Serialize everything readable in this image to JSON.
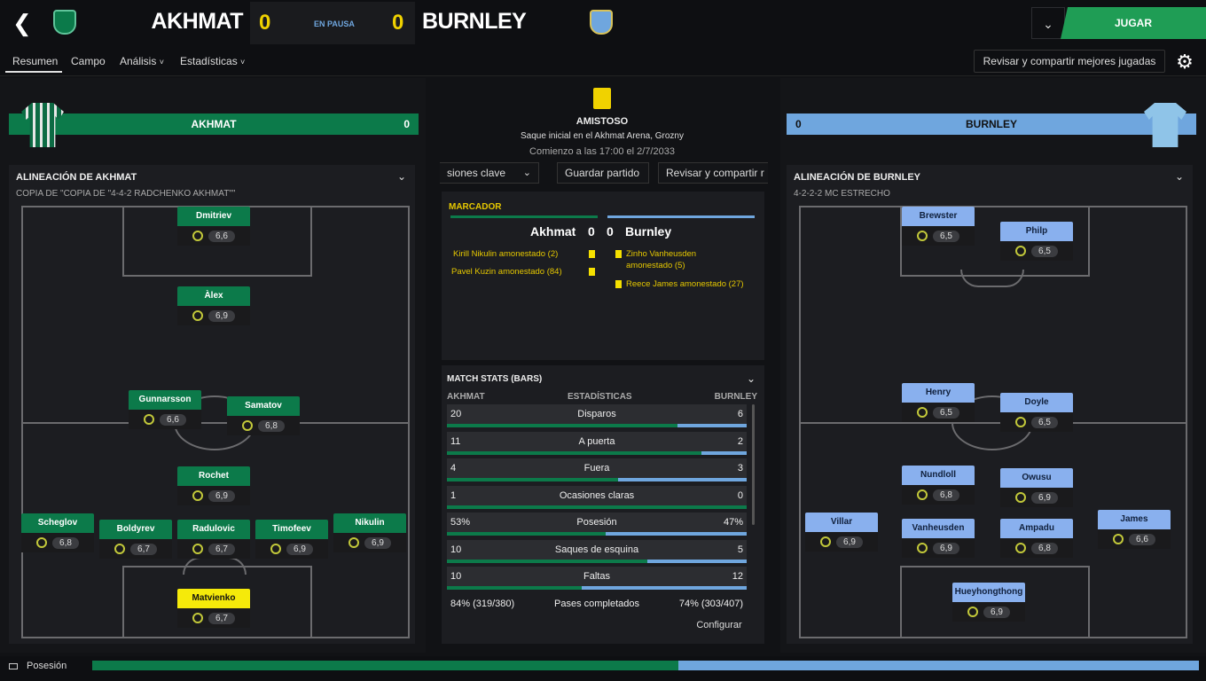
{
  "header": {
    "home_team": "AKHMAT",
    "away_team": "BURNLEY",
    "home_score": "0",
    "away_score": "0",
    "status": "EN PAUSA",
    "play_label": "JUGAR",
    "back_icon": "chevron-left-icon"
  },
  "nav": {
    "tabs": [
      "Resumen",
      "Campo",
      "Análisis",
      "Estadísticas"
    ],
    "share_label": "Revisar y compartir mejores jugadas",
    "settings_icon": "gear-icon"
  },
  "colors": {
    "home": "#0c7a4a",
    "away": "#6fa6de",
    "accent_yellow": "#f0d200"
  },
  "home_panel": {
    "bar_name": "AKHMAT",
    "bar_score": "0",
    "lineup_title": "ALINEACIÓN DE AKHMAT",
    "formation": "COPIA DE \"COPIA DE \"4-4-2 RADCHENKO AKHMAT\"\"",
    "players": [
      {
        "name": "Dmitriev",
        "rating": "6,6"
      },
      {
        "name": "Àlex",
        "rating": "6,9"
      },
      {
        "name": "Gunnarsson",
        "rating": "6,6"
      },
      {
        "name": "Samatov",
        "rating": "6,8"
      },
      {
        "name": "Rochet",
        "rating": "6,9"
      },
      {
        "name": "Scheglov",
        "rating": "6,8"
      },
      {
        "name": "Boldyrev",
        "rating": "6,7"
      },
      {
        "name": "Radulovic",
        "rating": "6,7"
      },
      {
        "name": "Timofeev",
        "rating": "6,9"
      },
      {
        "name": "Nikulin",
        "rating": "6,9"
      },
      {
        "name": "Matvienko",
        "rating": "6,7"
      }
    ]
  },
  "away_panel": {
    "bar_name": "BURNLEY",
    "bar_score": "0",
    "lineup_title": "ALINEACIÓN DE BURNLEY",
    "formation": "4-2-2-2 MC ESTRECHO",
    "players": [
      {
        "name": "Brewster",
        "rating": "6,5"
      },
      {
        "name": "Philp",
        "rating": "6,5"
      },
      {
        "name": "Henry",
        "rating": "6,5"
      },
      {
        "name": "Doyle",
        "rating": "6,5"
      },
      {
        "name": "Nundloll",
        "rating": "6,8"
      },
      {
        "name": "Owusu",
        "rating": "6,9"
      },
      {
        "name": "Villar",
        "rating": "6,9"
      },
      {
        "name": "Vanheusden",
        "rating": "6,9"
      },
      {
        "name": "Ampadu",
        "rating": "6,8"
      },
      {
        "name": "James",
        "rating": "6,6"
      },
      {
        "name": "Hueyhongthong",
        "rating": "6,9"
      }
    ]
  },
  "match": {
    "competition": "AMISTOSO",
    "kickoff": "Saque inicial en el Akhmat Arena, Grozny",
    "start": "Comienzo a las 17:00 el 2/7/2033",
    "btn_highlights": "siones clave",
    "btn_save": "Guardar partido",
    "btn_share": "Revisar y compartir r"
  },
  "scoreboard": {
    "title": "MARCADOR",
    "home": "Akhmat",
    "home_score": "0",
    "away": "Burnley",
    "away_score": "0",
    "home_events": [
      "Kirill Nikulin amonestado (2)",
      "Pavel Kuzin amonestado (84)"
    ],
    "away_events": [
      "Zinho Vanheusden amonestado (5)",
      "Reece James amonestado (27)"
    ]
  },
  "stats": {
    "title": "MATCH STATS (BARS)",
    "col_home": "AKHMAT",
    "col_mid": "ESTADÍSTICAS",
    "col_away": "BURNLEY",
    "rows": [
      {
        "label": "Disparos",
        "home": "20",
        "away": "6",
        "share": 0.77
      },
      {
        "label": "A puerta",
        "home": "11",
        "away": "2",
        "share": 0.85
      },
      {
        "label": "Fuera",
        "home": "4",
        "away": "3",
        "share": 0.57
      },
      {
        "label": "Ocasiones claras",
        "home": "1",
        "away": "0",
        "share": 1.0
      },
      {
        "label": "Posesión",
        "home": "53%",
        "away": "47%",
        "share": 0.53
      },
      {
        "label": "Saques de esquina",
        "home": "10",
        "away": "5",
        "share": 0.67
      },
      {
        "label": "Faltas",
        "home": "10",
        "away": "12",
        "share": 0.45
      },
      {
        "label": "Pases completados",
        "home": "84% (319/380)",
        "away": "74% (303/407)",
        "share": 0.5
      }
    ],
    "config_label": "Configurar"
  },
  "possession": {
    "label": "Posesión",
    "home_pct": 53
  }
}
